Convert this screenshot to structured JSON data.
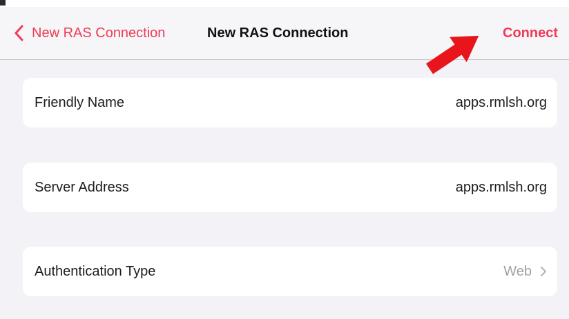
{
  "navbar": {
    "back_label": "New RAS Connection",
    "title": "New RAS Connection",
    "action_label": "Connect",
    "accent_color": "#ef3b55",
    "back_icon": "chevron-left-icon",
    "annotation_icon": "red-arrow-icon"
  },
  "form": {
    "friendly_name": {
      "label": "Friendly Name",
      "value": "apps.rmlsh.org"
    },
    "server_address": {
      "label": "Server Address",
      "value": "apps.rmlsh.org"
    },
    "authentication_type": {
      "label": "Authentication Type",
      "value": "Web",
      "icon": "chevron-right-icon"
    }
  }
}
